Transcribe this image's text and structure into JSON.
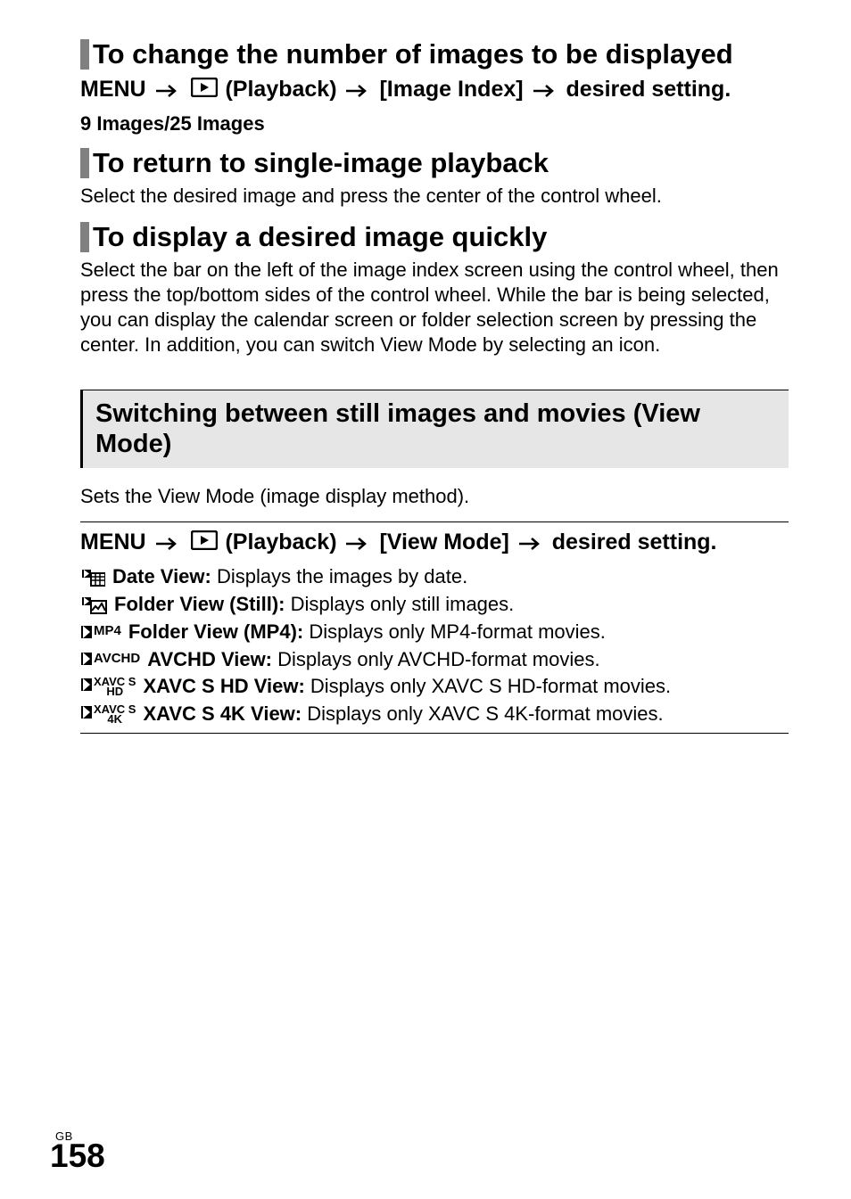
{
  "section1": {
    "heading": "To change the number of images to be displayed",
    "menu_prefix": "MENU",
    "menu_playback": "(Playback)",
    "menu_item": "[Image Index]",
    "menu_suffix": "desired setting.",
    "sub": "9 Images/25 Images"
  },
  "section2": {
    "heading": "To return to single-image playback",
    "body": "Select the desired image and press the center of the control wheel."
  },
  "section3": {
    "heading": "To display a desired image quickly",
    "body": "Select the bar on the left of the image index screen using the control wheel, then press the top/bottom sides of the control wheel. While the bar is being selected, you can display the calendar screen or folder selection screen by pressing the center. In addition, you can switch View Mode by selecting an icon."
  },
  "section4": {
    "box_heading": "Switching between still images and movies (View Mode)",
    "intro": "Sets the View Mode (image display method).",
    "menu_prefix": "MENU",
    "menu_playback": "(Playback)",
    "menu_item": "[View Mode]",
    "menu_suffix": "desired setting.",
    "items": [
      {
        "icon": "date",
        "label": "Date View:",
        "desc": " Displays the images by date."
      },
      {
        "icon": "still",
        "label": "Folder View (Still):",
        "desc": " Displays only still images."
      },
      {
        "icon": "mp4",
        "label": "Folder View (MP4):",
        "desc": " Displays only MP4-format movies."
      },
      {
        "icon": "avchd",
        "label": "AVCHD View:",
        "desc": " Displays only AVCHD-format movies."
      },
      {
        "icon": "xavcshd",
        "label": "XAVC S HD View:",
        "desc": " Displays only XAVC S HD-format movies."
      },
      {
        "icon": "xavcs4k",
        "label": "XAVC S 4K View:",
        "desc": " Displays only XAVC S 4K-format movies."
      }
    ]
  },
  "footer": {
    "region": "GB",
    "page": "158"
  },
  "icons": {
    "mp4": "MP4",
    "avchd": "AVCHD",
    "xavcshd_l1": "XAVC S",
    "xavcshd_l2": "HD",
    "xavcs4k_l1": "XAVC S",
    "xavcs4k_l2": "4K"
  }
}
